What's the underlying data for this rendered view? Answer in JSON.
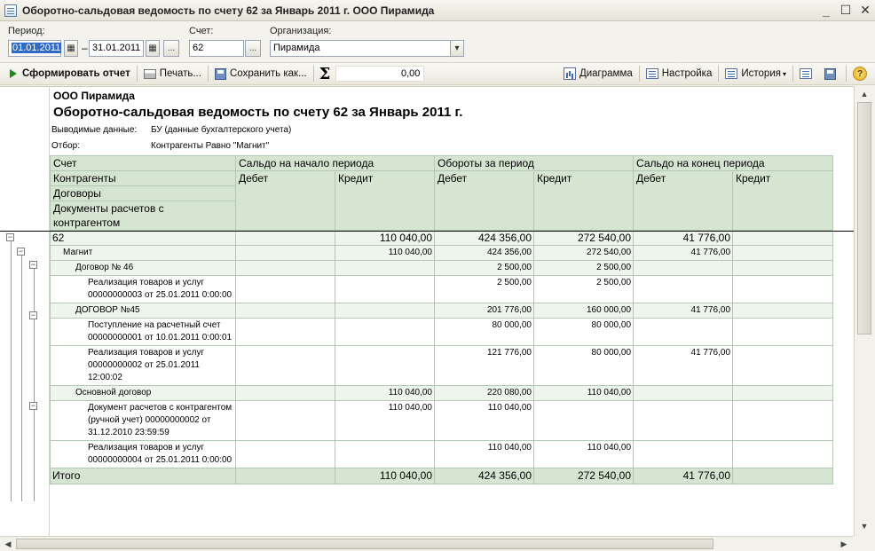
{
  "window": {
    "title": "Оборотно-сальдовая ведомость по счету 62 за Январь 2011 г. ООО Пирамида",
    "minimize": "_",
    "maximize": "☐",
    "close": "✕"
  },
  "params": {
    "period_label": "Период:",
    "date_from": "01.01.2011",
    "date_to": "31.01.2011",
    "dash": "–",
    "ellipsis": "...",
    "account_label": "Счет:",
    "account": "62",
    "org_label": "Организация:",
    "org": "Пирамида"
  },
  "toolbar": {
    "generate": "Сформировать отчет",
    "print": "Печать...",
    "save": "Сохранить как...",
    "sum_value": "0,00",
    "diagram": "Диаграмма",
    "settings": "Настройка",
    "history": "История",
    "help": "?"
  },
  "report": {
    "org": "ООО Пирамида",
    "title": "Оборотно-сальдовая ведомость по счету 62 за Январь 2011 г.",
    "output_label": "Выводимые данные:",
    "output_value": "БУ (данные бухгалтерского учета)",
    "filter_label": "Отбор:",
    "filter_value": "Контрагенты Равно \"Магнит\"",
    "header": {
      "account": "Счет",
      "counterparties": "Контрагенты",
      "contracts": "Договоры",
      "docs": "Документы расчетов с контрагентом",
      "opening": "Сальдо на начало периода",
      "turnover": "Обороты за период",
      "closing": "Сальдо на конец периода",
      "debit": "Дебет",
      "credit": "Кредит"
    },
    "rows": [
      {
        "label": "62",
        "od": "",
        "oc": "110 040,00",
        "td": "424 356,00",
        "tc": "272 540,00",
        "cd": "41 776,00",
        "cc": ""
      },
      {
        "label": "Магнит",
        "od": "",
        "oc": "110 040,00",
        "td": "424 356,00",
        "tc": "272 540,00",
        "cd": "41 776,00",
        "cc": ""
      },
      {
        "label": "Договор № 46",
        "od": "",
        "oc": "",
        "td": "2 500,00",
        "tc": "2 500,00",
        "cd": "",
        "cc": ""
      },
      {
        "label": "Реализация товаров и услуг 00000000003 от 25.01.2011 0:00:00",
        "od": "",
        "oc": "",
        "td": "2 500,00",
        "tc": "2 500,00",
        "cd": "",
        "cc": ""
      },
      {
        "label": "ДОГОВОР №45",
        "od": "",
        "oc": "",
        "td": "201 776,00",
        "tc": "160 000,00",
        "cd": "41 776,00",
        "cc": ""
      },
      {
        "label": "Поступление на расчетный счет 00000000001 от 10.01.2011 0:00:01",
        "od": "",
        "oc": "",
        "td": "80 000,00",
        "tc": "80 000,00",
        "cd": "",
        "cc": ""
      },
      {
        "label": "Реализация товаров и услуг 00000000002 от 25.01.2011 12:00:02",
        "od": "",
        "oc": "",
        "td": "121 776,00",
        "tc": "80 000,00",
        "cd": "41 776,00",
        "cc": ""
      },
      {
        "label": "Основной договор",
        "od": "",
        "oc": "110 040,00",
        "td": "220 080,00",
        "tc": "110 040,00",
        "cd": "",
        "cc": ""
      },
      {
        "label": "Документ расчетов с контрагентом (ручной учет) 00000000002 от 31.12.2010 23:59:59",
        "od": "",
        "oc": "110 040,00",
        "td": "110 040,00",
        "tc": "",
        "cd": "",
        "cc": ""
      },
      {
        "label": "Реализация товаров и услуг 00000000004 от 25.01.2011 0:00:00",
        "od": "",
        "oc": "",
        "td": "110 040,00",
        "tc": "110 040,00",
        "cd": "",
        "cc": ""
      }
    ],
    "total": {
      "label": "Итого",
      "od": "",
      "oc": "110 040,00",
      "td": "424 356,00",
      "tc": "272 540,00",
      "cd": "41 776,00",
      "cc": ""
    }
  }
}
